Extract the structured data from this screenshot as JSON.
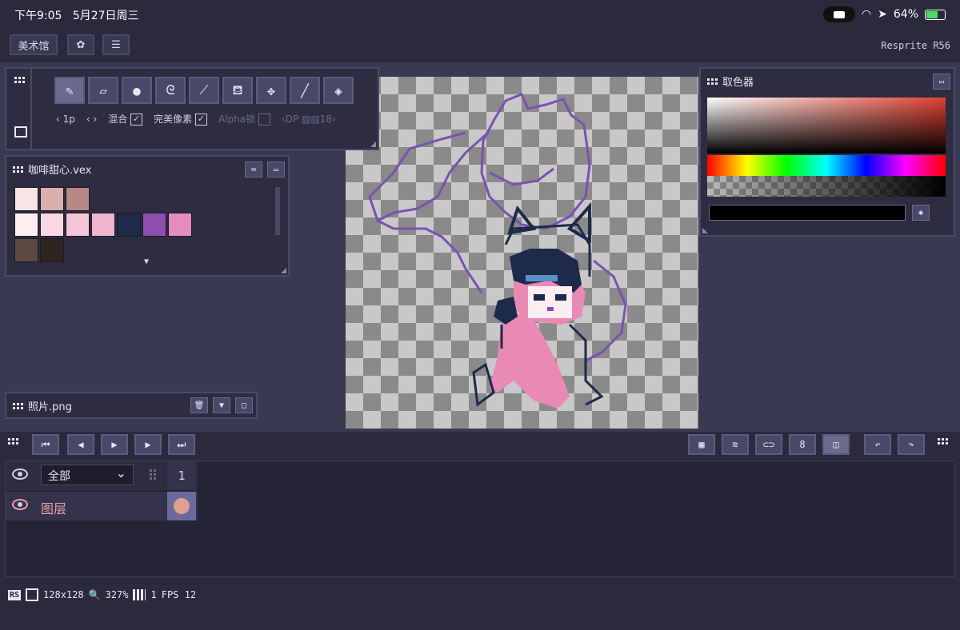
{
  "status": {
    "time": "下午9:05",
    "date": "5月27日周三",
    "battery": "64%"
  },
  "topbar": {
    "gallery_label": "美术馆",
    "app_title": "Resprite R56"
  },
  "toolbar": {
    "brush_size": "‹ 1p",
    "arrows": "‹ ›",
    "blend_label": "混合",
    "perfect_pixel_label": "完美像素",
    "alpha_lock_label": "Alpha锁",
    "dither_label": "‹DP",
    "dither_value": "18›"
  },
  "palette": {
    "title": "咖啡甜心.vex",
    "row1": [
      "#f8e4e4",
      "#d8b0ac",
      "#b88884"
    ],
    "row2": [
      "#fdeef2",
      "#f9d8e2",
      "#f4c6d8",
      "#f0b4cc",
      "#1e2a4a",
      "#8c4fb0",
      "#e48ec0"
    ],
    "row3": [
      "#5c4a40",
      "#2e2420"
    ]
  },
  "color_picker": {
    "title": "取色器"
  },
  "reference": {
    "title": "照片.png"
  },
  "timeline": {
    "layer_filter": "全部",
    "frame_number": "1",
    "layer_name": "图层",
    "layer_color": "#e0a090"
  },
  "footer": {
    "tag": "RS",
    "canvas_size": "128x128",
    "zoom": "327%",
    "frames": "1",
    "fps_label": "FPS 12"
  }
}
